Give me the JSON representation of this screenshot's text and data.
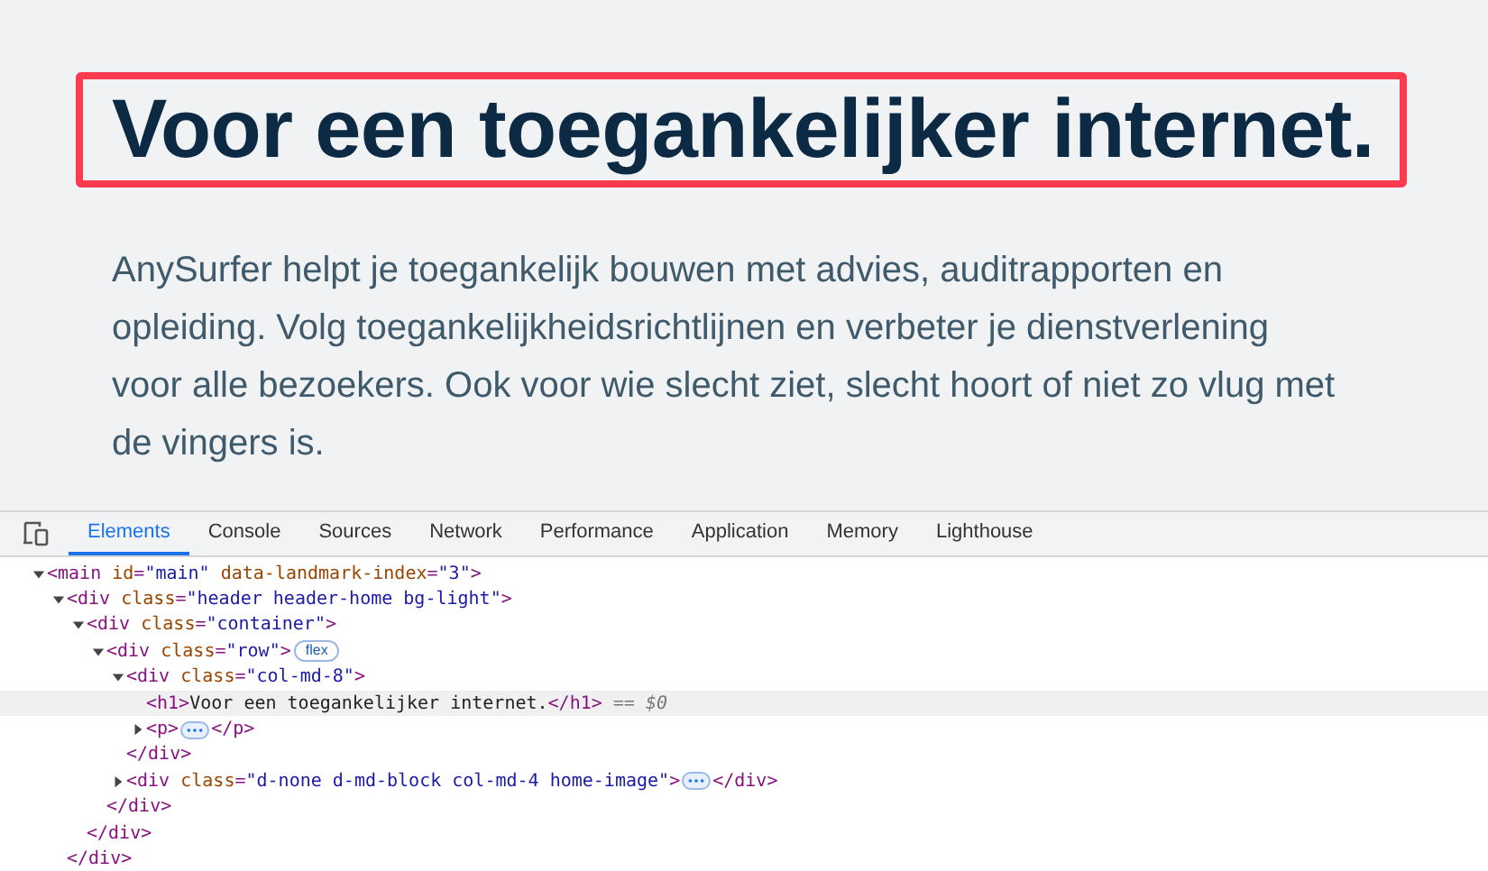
{
  "page": {
    "heading": "Voor een toegankelijker internet.",
    "heading_highlighted": true,
    "paragraph": "AnySurfer helpt je toegankelijk bouwen met advies, auditrapporten en opleiding. Volg toegankelijkheidsrichtlijnen en verbeter je dienstverlening voor alle bezoekers. Ook voor wie slecht ziet, slecht hoort of niet zo vlug met de vingers is."
  },
  "devtools": {
    "tabs": [
      {
        "label": "Elements",
        "selected": true
      },
      {
        "label": "Console",
        "selected": false
      },
      {
        "label": "Sources",
        "selected": false
      },
      {
        "label": "Network",
        "selected": false
      },
      {
        "label": "Performance",
        "selected": false
      },
      {
        "label": "Application",
        "selected": false
      },
      {
        "label": "Memory",
        "selected": false
      },
      {
        "label": "Lighthouse",
        "selected": false
      }
    ],
    "tree": [
      {
        "open": [
          {
            "kind": "tag",
            "text": "<main"
          },
          {
            "kind": "attr",
            "text": " id"
          },
          {
            "kind": "tag",
            "text": "="
          },
          {
            "kind": "value",
            "text": "\"main\""
          },
          {
            "kind": "attr",
            "text": " data-landmark-index"
          },
          {
            "kind": "tag",
            "text": "="
          },
          {
            "kind": "value",
            "text": "\"3\""
          },
          {
            "kind": "tag",
            "text": ">"
          }
        ],
        "expanded": true,
        "selected": false,
        "children": [
          {
            "open": [
              {
                "kind": "tag",
                "text": "<div"
              },
              {
                "kind": "attr",
                "text": " class"
              },
              {
                "kind": "tag",
                "text": "="
              },
              {
                "kind": "value",
                "text": "\"header header-home bg-light\""
              },
              {
                "kind": "tag",
                "text": ">"
              }
            ],
            "expanded": true,
            "selected": false,
            "children": [
              {
                "open": [
                  {
                    "kind": "tag",
                    "text": "<div"
                  },
                  {
                    "kind": "attr",
                    "text": " class"
                  },
                  {
                    "kind": "tag",
                    "text": "="
                  },
                  {
                    "kind": "value",
                    "text": "\"container\""
                  },
                  {
                    "kind": "tag",
                    "text": ">"
                  }
                ],
                "expanded": true,
                "selected": false,
                "children": [
                  {
                    "open": [
                      {
                        "kind": "tag",
                        "text": "<div"
                      },
                      {
                        "kind": "attr",
                        "text": " class"
                      },
                      {
                        "kind": "tag",
                        "text": "="
                      },
                      {
                        "kind": "value",
                        "text": "\"row\""
                      },
                      {
                        "kind": "tag",
                        "text": ">"
                      }
                    ],
                    "badge": "flex",
                    "expanded": true,
                    "selected": false,
                    "children": [
                      {
                        "open": [
                          {
                            "kind": "tag",
                            "text": "<div"
                          },
                          {
                            "kind": "attr",
                            "text": " class"
                          },
                          {
                            "kind": "tag",
                            "text": "="
                          },
                          {
                            "kind": "value",
                            "text": "\"col-md-8\""
                          },
                          {
                            "kind": "tag",
                            "text": ">"
                          }
                        ],
                        "expanded": true,
                        "selected": false,
                        "children": [
                          {
                            "open": [
                              {
                                "kind": "tag",
                                "text": "<h1>"
                              },
                              {
                                "kind": "text",
                                "text": "Voor een toegankelijker internet."
                              },
                              {
                                "kind": "tag",
                                "text": "</h1>"
                              }
                            ],
                            "suffix": "== $0",
                            "selected": true
                          },
                          {
                            "open": [
                              {
                                "kind": "tag",
                                "text": "<p>"
                              }
                            ],
                            "expanded": false,
                            "selected": false,
                            "close": [
                              {
                                "kind": "tag",
                                "text": "</p>"
                              }
                            ]
                          }
                        ],
                        "close": [
                          {
                            "kind": "tag",
                            "text": "</div>"
                          }
                        ]
                      },
                      {
                        "open": [
                          {
                            "kind": "tag",
                            "text": "<div"
                          },
                          {
                            "kind": "attr",
                            "text": " class"
                          },
                          {
                            "kind": "tag",
                            "text": "="
                          },
                          {
                            "kind": "value",
                            "text": "\"d-none d-md-block col-md-4 home-image\""
                          },
                          {
                            "kind": "tag",
                            "text": ">"
                          }
                        ],
                        "expanded": false,
                        "selected": false,
                        "close": [
                          {
                            "kind": "tag",
                            "text": "</div>"
                          }
                        ]
                      }
                    ],
                    "close": [
                      {
                        "kind": "tag",
                        "text": "</div>"
                      }
                    ]
                  }
                ],
                "close": [
                  {
                    "kind": "tag",
                    "text": "</div>"
                  }
                ]
              }
            ],
            "close": [
              {
                "kind": "tag",
                "text": "</div>"
              }
            ]
          }
        ]
      }
    ]
  }
}
